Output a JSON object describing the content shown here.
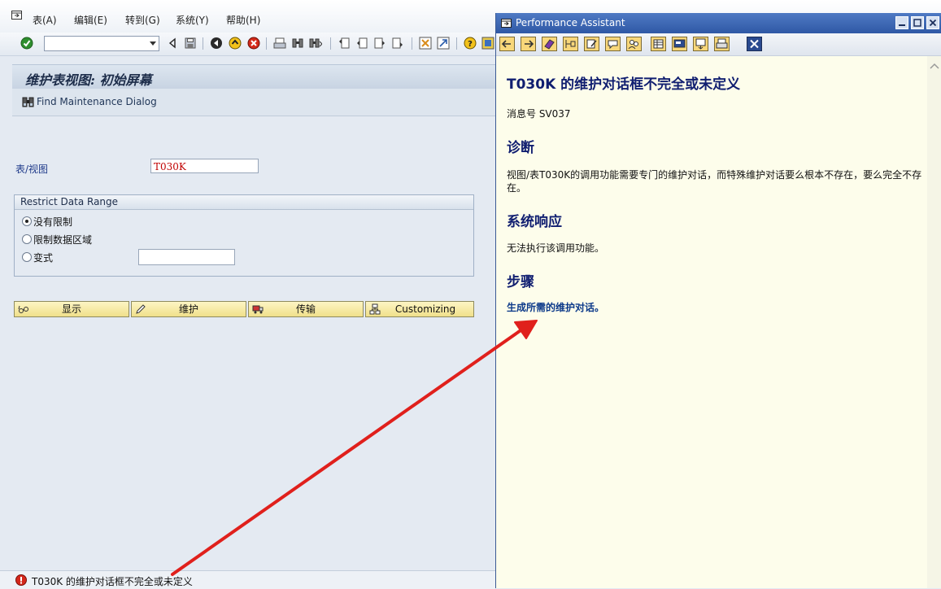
{
  "menubar": {
    "items": [
      "表(A)",
      "编辑(E)",
      "转到(G)",
      "系统(Y)",
      "帮助(H)"
    ]
  },
  "toolbar": {
    "command_field_value": ""
  },
  "screen": {
    "title": "维护表视图: 初始屏幕",
    "app_toolbar_label": "Find Maintenance Dialog",
    "table_label": "表/视图",
    "table_value": "T030K"
  },
  "restrict": {
    "header": "Restrict Data Range",
    "options": [
      "没有限制",
      "限制数据区域",
      "变式"
    ],
    "selected": "没有限制",
    "variant_value": ""
  },
  "buttons": {
    "display": "显示",
    "maintain": "维护",
    "transport": "传输",
    "customizing": "Customizing"
  },
  "status": {
    "message": "T030K 的维护对话框不完全或未定义"
  },
  "assistant": {
    "window_title": "Performance Assistant",
    "title": "T030K 的维护对话框不完全或未定义",
    "message_no": "消息号  SV037",
    "diagnosis_heading": "诊断",
    "diagnosis_text": "视图/表T030K的调用功能需要专门的维护对话，而特殊维护对话要么根本不存在，要么完全不存在。",
    "response_heading": "系统响应",
    "response_text": "无法执行该调用功能。",
    "procedure_heading": "步骤",
    "procedure_link": "生成所需的维护对话。"
  },
  "colors": {
    "arrow": "#e0201c",
    "heading": "#101e70",
    "assistant_bg": "#fdfdeb",
    "button_bg": "#f4e69c"
  }
}
